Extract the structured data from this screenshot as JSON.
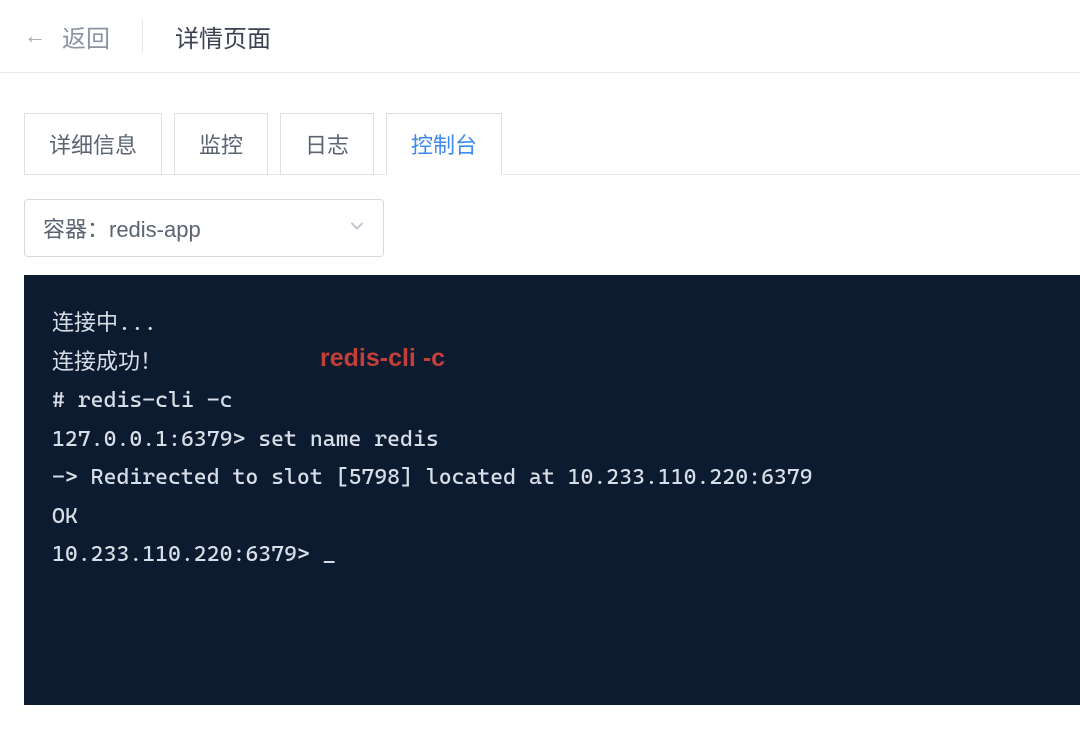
{
  "header": {
    "back_label": "返回",
    "page_title": "详情页面"
  },
  "tabs": {
    "items": [
      {
        "label": "详细信息",
        "active": false
      },
      {
        "label": "监控",
        "active": false
      },
      {
        "label": "日志",
        "active": false
      },
      {
        "label": "控制台",
        "active": true
      }
    ]
  },
  "selector": {
    "label": "容器：redis-app"
  },
  "annotation": {
    "text": "redis-cli -c"
  },
  "terminal": {
    "lines": [
      "连接中...",
      "连接成功！",
      "# redis-cli -c",
      "127.0.0.1:6379> set name redis",
      "-> Redirected to slot [5798] located at 10.233.110.220:6379",
      "OK",
      "10.233.110.220:6379> _"
    ]
  }
}
